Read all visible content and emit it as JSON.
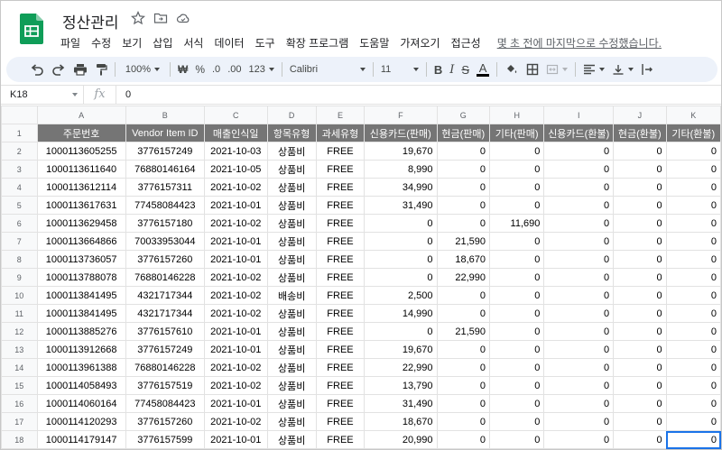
{
  "doc": {
    "title": "정산관리",
    "last_edit": "몇 초 전에 마지막으로 수정했습니다."
  },
  "menu": [
    "파일",
    "수정",
    "보기",
    "삽입",
    "서식",
    "데이터",
    "도구",
    "확장 프로그램",
    "도움말",
    "가져오기",
    "접근성"
  ],
  "toolbar": {
    "zoom": "100%",
    "currency": "₩",
    "percent": "%",
    "decrease_decimal": ".0",
    "increase_decimal": ".00",
    "number_format": "123",
    "font": "Calibri",
    "font_size": "11",
    "bold": "B",
    "italic": "I",
    "strike": "S",
    "text_color": "A"
  },
  "formula_bar": {
    "cell_ref": "K18",
    "fx": "fx",
    "value": "0"
  },
  "columns": [
    "A",
    "B",
    "C",
    "D",
    "E",
    "F",
    "G",
    "H",
    "I",
    "J",
    "K"
  ],
  "header_row": {
    "num": "1",
    "cells": [
      "주문번호",
      "Vendor Item ID",
      "매출인식일",
      "항목유형",
      "과세유형",
      "신용카드(판매)",
      "현금(판매)",
      "기타(판매)",
      "신용카드(환불)",
      "현금(환불)",
      "기타(환불)"
    ]
  },
  "rows": [
    {
      "num": "2",
      "cells": [
        "1000113605255",
        "3776157249",
        "2021-10-03",
        "상품비",
        "FREE",
        "19,670",
        "0",
        "0",
        "0",
        "0",
        "0"
      ]
    },
    {
      "num": "3",
      "cells": [
        "1000113611640",
        "76880146164",
        "2021-10-05",
        "상품비",
        "FREE",
        "8,990",
        "0",
        "0",
        "0",
        "0",
        "0"
      ]
    },
    {
      "num": "4",
      "cells": [
        "1000113612114",
        "3776157311",
        "2021-10-02",
        "상품비",
        "FREE",
        "34,990",
        "0",
        "0",
        "0",
        "0",
        "0"
      ]
    },
    {
      "num": "5",
      "cells": [
        "1000113617631",
        "77458084423",
        "2021-10-01",
        "상품비",
        "FREE",
        "31,490",
        "0",
        "0",
        "0",
        "0",
        "0"
      ]
    },
    {
      "num": "6",
      "cells": [
        "1000113629458",
        "3776157180",
        "2021-10-02",
        "상품비",
        "FREE",
        "0",
        "0",
        "11,690",
        "0",
        "0",
        "0"
      ]
    },
    {
      "num": "7",
      "cells": [
        "1000113664866",
        "70033953044",
        "2021-10-01",
        "상품비",
        "FREE",
        "0",
        "21,590",
        "0",
        "0",
        "0",
        "0"
      ]
    },
    {
      "num": "8",
      "cells": [
        "1000113736057",
        "3776157260",
        "2021-10-01",
        "상품비",
        "FREE",
        "0",
        "18,670",
        "0",
        "0",
        "0",
        "0"
      ]
    },
    {
      "num": "9",
      "cells": [
        "1000113788078",
        "76880146228",
        "2021-10-02",
        "상품비",
        "FREE",
        "0",
        "22,990",
        "0",
        "0",
        "0",
        "0"
      ]
    },
    {
      "num": "10",
      "cells": [
        "1000113841495",
        "4321717344",
        "2021-10-02",
        "배송비",
        "FREE",
        "2,500",
        "0",
        "0",
        "0",
        "0",
        "0"
      ]
    },
    {
      "num": "11",
      "cells": [
        "1000113841495",
        "4321717344",
        "2021-10-02",
        "상품비",
        "FREE",
        "14,990",
        "0",
        "0",
        "0",
        "0",
        "0"
      ]
    },
    {
      "num": "12",
      "cells": [
        "1000113885276",
        "3776157610",
        "2021-10-01",
        "상품비",
        "FREE",
        "0",
        "21,590",
        "0",
        "0",
        "0",
        "0"
      ]
    },
    {
      "num": "13",
      "cells": [
        "1000113912668",
        "3776157249",
        "2021-10-01",
        "상품비",
        "FREE",
        "19,670",
        "0",
        "0",
        "0",
        "0",
        "0"
      ]
    },
    {
      "num": "14",
      "cells": [
        "1000113961388",
        "76880146228",
        "2021-10-02",
        "상품비",
        "FREE",
        "22,990",
        "0",
        "0",
        "0",
        "0",
        "0"
      ]
    },
    {
      "num": "15",
      "cells": [
        "1000114058493",
        "3776157519",
        "2021-10-02",
        "상품비",
        "FREE",
        "13,790",
        "0",
        "0",
        "0",
        "0",
        "0"
      ]
    },
    {
      "num": "16",
      "cells": [
        "1000114060164",
        "77458084423",
        "2021-10-01",
        "상품비",
        "FREE",
        "31,490",
        "0",
        "0",
        "0",
        "0",
        "0"
      ]
    },
    {
      "num": "17",
      "cells": [
        "1000114120293",
        "3776157260",
        "2021-10-02",
        "상품비",
        "FREE",
        "18,670",
        "0",
        "0",
        "0",
        "0",
        "0"
      ]
    },
    {
      "num": "18",
      "cells": [
        "1000114179147",
        "3776157599",
        "2021-10-01",
        "상품비",
        "FREE",
        "20,990",
        "0",
        "0",
        "0",
        "0",
        "0"
      ]
    }
  ],
  "selected_cell": "K18",
  "colors": {
    "header_fill": "#757575",
    "selection": "#1a73e8",
    "logo_green": "#0f9d58"
  }
}
